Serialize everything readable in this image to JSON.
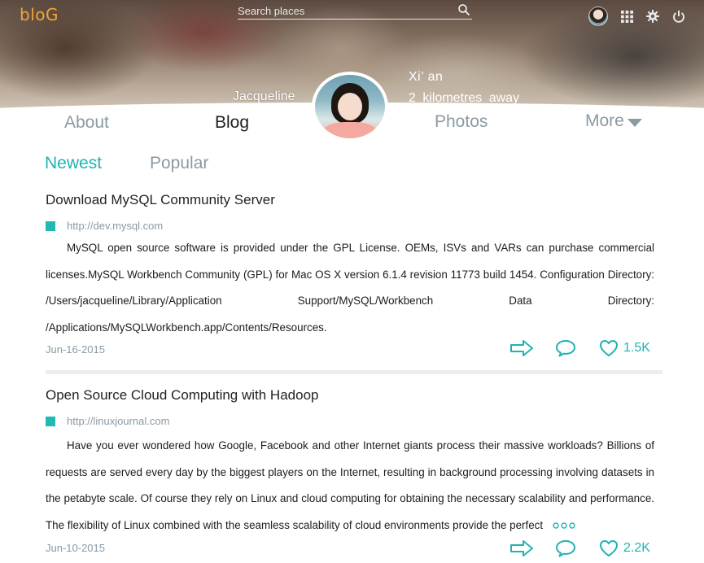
{
  "header": {
    "logo": "bloG",
    "search_placeholder": "Search places",
    "icons": [
      "avatar",
      "grid-icon",
      "gear-icon",
      "power-icon"
    ]
  },
  "profile": {
    "name": "Jacqueline",
    "city": "Xi’ an",
    "distance": "2 kilometres away"
  },
  "nav": {
    "about": "About",
    "blog": "Blog",
    "photos": "Photos",
    "more": "More",
    "active": "Blog"
  },
  "tabs": {
    "newest": "Newest",
    "popular": "Popular",
    "active": "Newest"
  },
  "colors": {
    "accent": "#21b3b0",
    "logo": "#f2a33a",
    "muted": "#8a9aa3"
  },
  "posts": [
    {
      "title": "Download MySQL Community Server",
      "url": "http://dev.mysql.com",
      "body": "MySQL open source software is provided under the GPL License.  OEMs, ISVs and VARs can purchase commercial licenses.MySQL Workbench Community (GPL) for Mac OS X version 6.1.4  revision 11773 build 1454. Configuration Directory: /Users/jacqueline/Library/Application Support/MySQL/Workbench  Data Directory: /Applications/MySQLWorkbench.app/Contents/Resources.",
      "date": "Jun-16-2015",
      "likes": "1.5K"
    },
    {
      "title": "Open Source Cloud Computing with Hadoop",
      "url": "http://linuxjournal.com",
      "body": "Have you ever wondered how Google, Facebook and other Internet giants process their massive workloads? Billions of requests are served every day by the biggest players on the Internet, resulting in background processing involving datasets in the petabyte scale. Of course they rely on Linux and cloud computing for obtaining the necessary scalability and performance. The flexibility of Linux combined with the seamless scalability of cloud environments provide the perfect",
      "date": "Jun-10-2015",
      "likes": "2.2K"
    }
  ]
}
